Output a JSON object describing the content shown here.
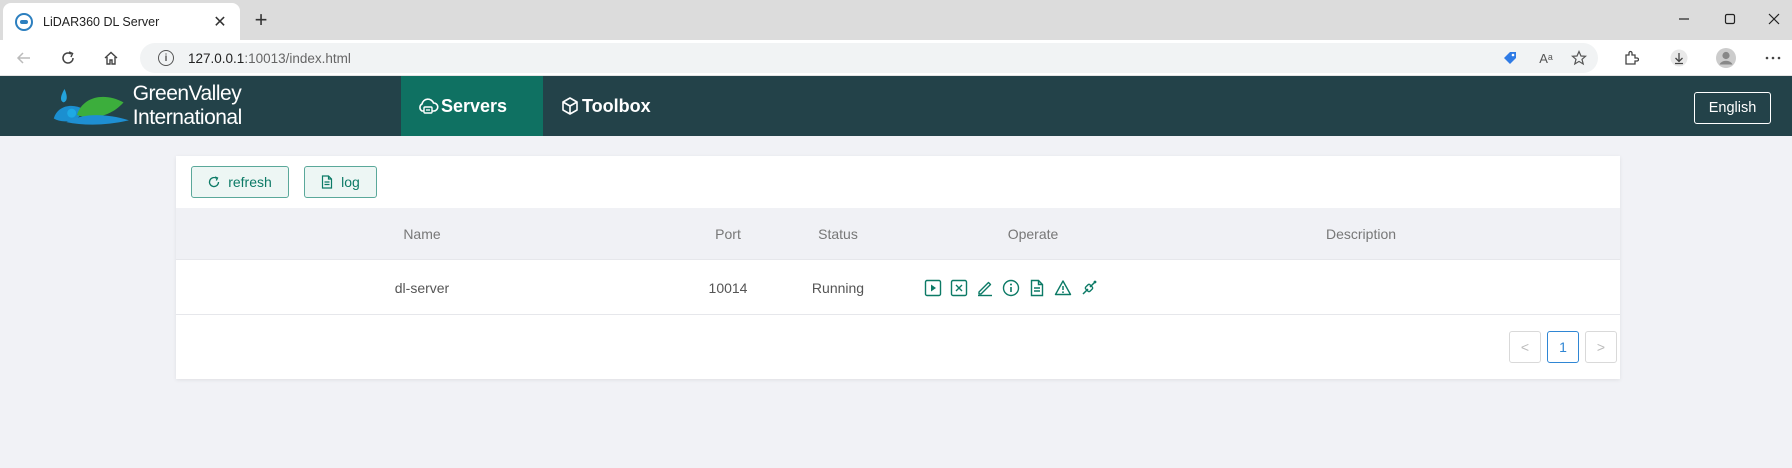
{
  "browser": {
    "tab_title": "LiDAR360 DL Server",
    "url_host": "127.0.0.1",
    "url_rest": ":10013/index.html",
    "read_aloud_label": "Aᵃ"
  },
  "app": {
    "brand": "GreenValley International",
    "nav": [
      {
        "label": "Servers",
        "active": true
      },
      {
        "label": "Toolbox",
        "active": false
      }
    ],
    "language_button": "English",
    "accent_color": "#0f7162",
    "header_color": "#234249"
  },
  "toolbar": {
    "refresh_label": "refresh",
    "log_label": "log"
  },
  "table": {
    "columns": [
      "Name",
      "Port",
      "Status",
      "Operate",
      "Description"
    ],
    "rows": [
      {
        "name": "dl-server",
        "port": "10014",
        "status": "Running",
        "description": ""
      }
    ],
    "operate_icons": [
      "play-icon",
      "stop-icon",
      "edit-icon",
      "info-icon",
      "document-icon",
      "warning-icon",
      "link-icon"
    ]
  },
  "pagination": {
    "current_page": "1",
    "prev": "<",
    "next": ">"
  }
}
